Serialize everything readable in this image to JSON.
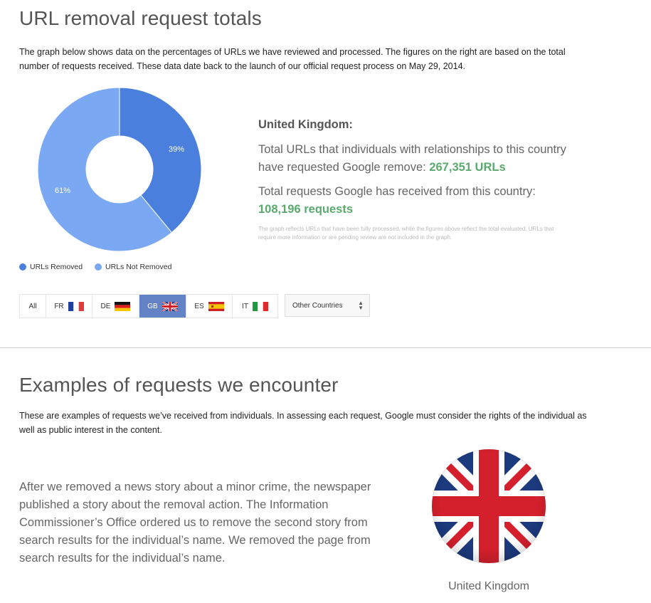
{
  "section1": {
    "title": "URL removal request totals",
    "intro": "The graph below shows data on the percentages of URLs we have reviewed and processed. The figures on the right are based on the total number of requests received. These data date back to the launch of our official request process on May 29, 2014."
  },
  "chart_data": {
    "type": "pie",
    "donut": true,
    "slices": [
      {
        "label": "URLs Removed",
        "value": 39,
        "display": "39%",
        "color": "#4a7fde"
      },
      {
        "label": "URLs Not Removed",
        "value": 61,
        "display": "61%",
        "color": "#7aa8f2"
      }
    ],
    "legend_position": "bottom-left"
  },
  "legend": {
    "removed": "URLs Removed",
    "not_removed": "URLs Not Removed"
  },
  "stats": {
    "country": "United Kingdom:",
    "urls_text": "Total URLs that individuals with relationships to this country have requested Google remove: ",
    "urls_value": "267,351 URLs",
    "requests_text": "Total requests Google has received from this country: ",
    "requests_value": "108,196 requests",
    "note": "The graph reflects URLs that have been fully processed, while the figures above reflect the total evaluated. URLs that require more information or are pending review are not included in the graph."
  },
  "tabs": [
    {
      "label": "All",
      "flag": ""
    },
    {
      "label": "FR",
      "flag": "france-flag-icon"
    },
    {
      "label": "DE",
      "flag": "germany-flag-icon"
    },
    {
      "label": "GB",
      "flag": "uk-flag-icon",
      "active": true
    },
    {
      "label": "ES",
      "flag": "spain-flag-icon"
    },
    {
      "label": "IT",
      "flag": "italy-flag-icon"
    }
  ],
  "select": {
    "value": "Other Countries",
    "icon": "updown-arrows-icon"
  },
  "section2": {
    "title": "Examples of requests we encounter",
    "intro": "These are examples of requests we’ve received from individuals. In assessing each request, Google must consider the rights of the individual as well as public interest in the content.",
    "example": "After we removed a news story about a minor crime, the newspaper published a story about the removal action. The Information Commissioner’s Office ordered us to remove the second story from search results for the individual’s name. We removed the page from search results for the individual’s name.",
    "country_caption": "United Kingdom"
  },
  "colors": {
    "active_tab": "#6482c6",
    "stat_number": "#5aaa6e"
  }
}
